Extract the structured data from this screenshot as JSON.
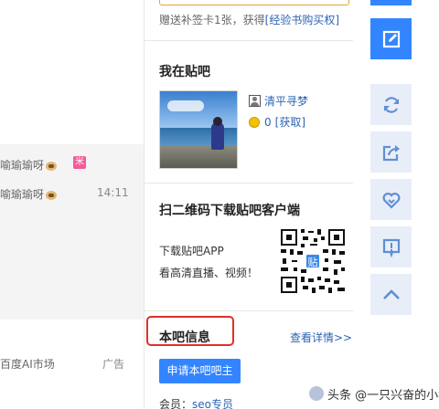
{
  "feed": {
    "line1": "喻瑜瑜呀",
    "line2": "喻瑜瑜呀",
    "badge": "米",
    "time": "14:11",
    "ad_left": "百度AI市场",
    "ad_right": "广告"
  },
  "sign": {
    "gift_text": "赠送补签卡1张，获得",
    "gift_link": "[经验书购买权]"
  },
  "my_bar": {
    "title": "我在贴吧",
    "username": "清平寻梦",
    "coins": "0",
    "claim_link": "[获取]"
  },
  "app": {
    "title": "扫二维码下载贴吧客户端",
    "line1": "下载贴吧APP",
    "line2": "看高清直播、视频！",
    "qr_logo": "贴"
  },
  "bar_info": {
    "title": "本吧信息",
    "detail_link": "查看详情>>",
    "apply_button": "申请本吧吧主",
    "member_label": "会员：",
    "member_value": "seo专员"
  },
  "toolbar": {
    "active_color": "#3385ff",
    "inactive_color": "#e8eef8",
    "icons": [
      "edit-icon",
      "refresh-icon",
      "share-icon",
      "favorite-icon",
      "report-icon",
      "back-to-top-icon"
    ]
  },
  "watermark": {
    "text": "头条 @一只兴奋的小猪"
  }
}
